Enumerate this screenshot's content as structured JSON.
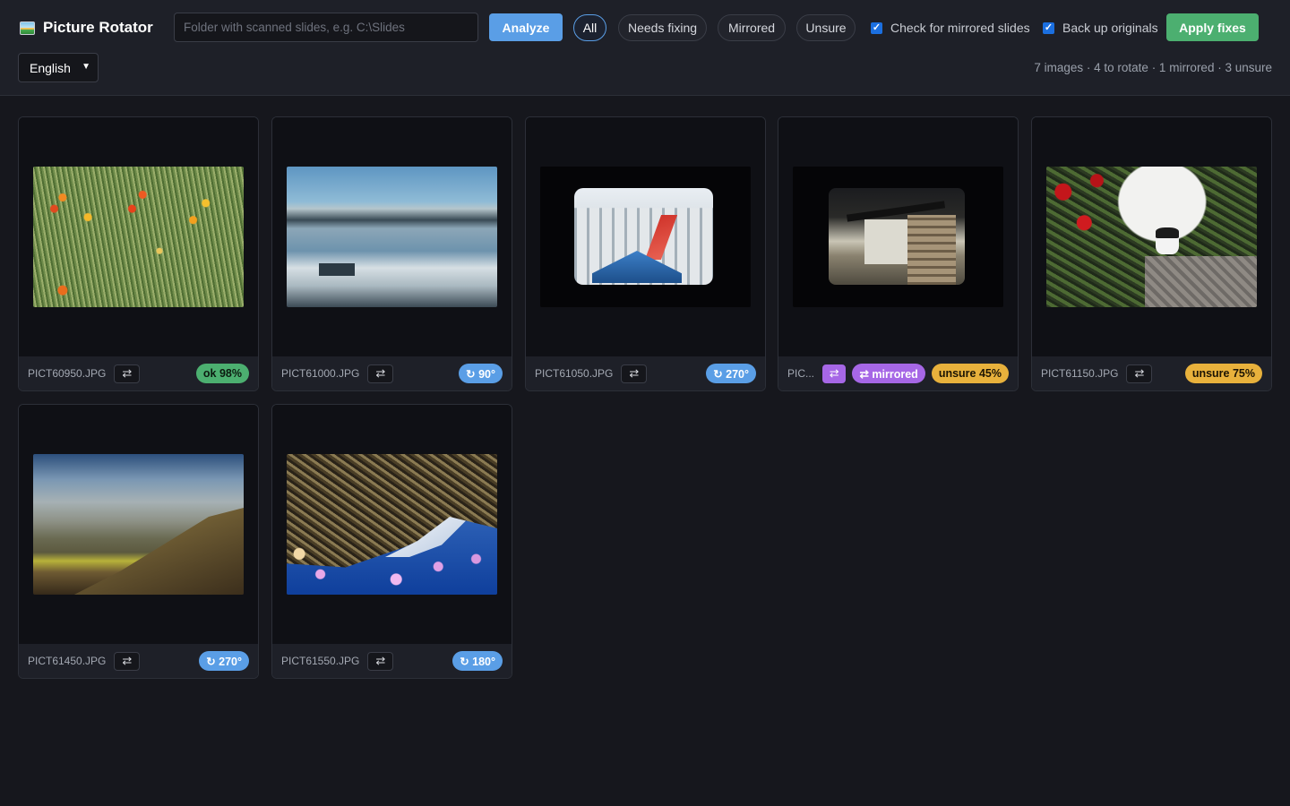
{
  "app": {
    "title": "Picture Rotator",
    "icon": "picture-icon"
  },
  "toolbar": {
    "folder_placeholder": "Folder with scanned slides, e.g. C:\\Slides",
    "folder_value": "",
    "analyze_label": "Analyze",
    "filters": [
      {
        "label": "All",
        "active": true
      },
      {
        "label": "Needs fixing",
        "active": false
      },
      {
        "label": "Mirrored",
        "active": false
      },
      {
        "label": "Unsure",
        "active": false
      }
    ],
    "check_mirrored_label": "Check for mirrored slides",
    "check_mirrored_checked": true,
    "backup_label": "Back up originals",
    "backup_checked": true,
    "apply_label": "Apply fixes",
    "language": "English",
    "summary": "7 images · 4 to rotate · 1 mirrored · 3 unsure"
  },
  "colors": {
    "accent_blue": "#5a9ee6",
    "ok_green": "#4caf70",
    "unsure_yellow": "#e8b13c",
    "mirror_purple": "#a667e6",
    "background": "#16171d"
  },
  "cards": [
    {
      "filename": "PICT60950.JPG",
      "flip_icon": "⇄",
      "badges": [
        {
          "kind": "ok",
          "text": "ok 98%"
        }
      ]
    },
    {
      "filename": "PICT61000.JPG",
      "flip_icon": "⇄",
      "badges": [
        {
          "kind": "rot",
          "text": "↻ 90°"
        }
      ]
    },
    {
      "filename": "PICT61050.JPG",
      "flip_icon": "⇄",
      "badges": [
        {
          "kind": "rot",
          "text": "↻ 270°"
        }
      ]
    },
    {
      "filename": "PIC...",
      "flip_icon": "⇄",
      "flip_active": true,
      "badges": [
        {
          "kind": "mirror",
          "text": "⇄ mirrored"
        },
        {
          "kind": "unsure",
          "text": "unsure 45%"
        }
      ]
    },
    {
      "filename": "PICT61150.JPG",
      "flip_icon": "⇄",
      "badges": [
        {
          "kind": "unsure",
          "text": "unsure 75%"
        }
      ]
    },
    {
      "filename": "PICT61450.JPG",
      "flip_icon": "⇄",
      "badges": [
        {
          "kind": "rot",
          "text": "↻ 270°"
        }
      ]
    },
    {
      "filename": "PICT61550.JPG",
      "flip_icon": "⇄",
      "badges": [
        {
          "kind": "rot",
          "text": "↻ 180°"
        }
      ]
    }
  ]
}
